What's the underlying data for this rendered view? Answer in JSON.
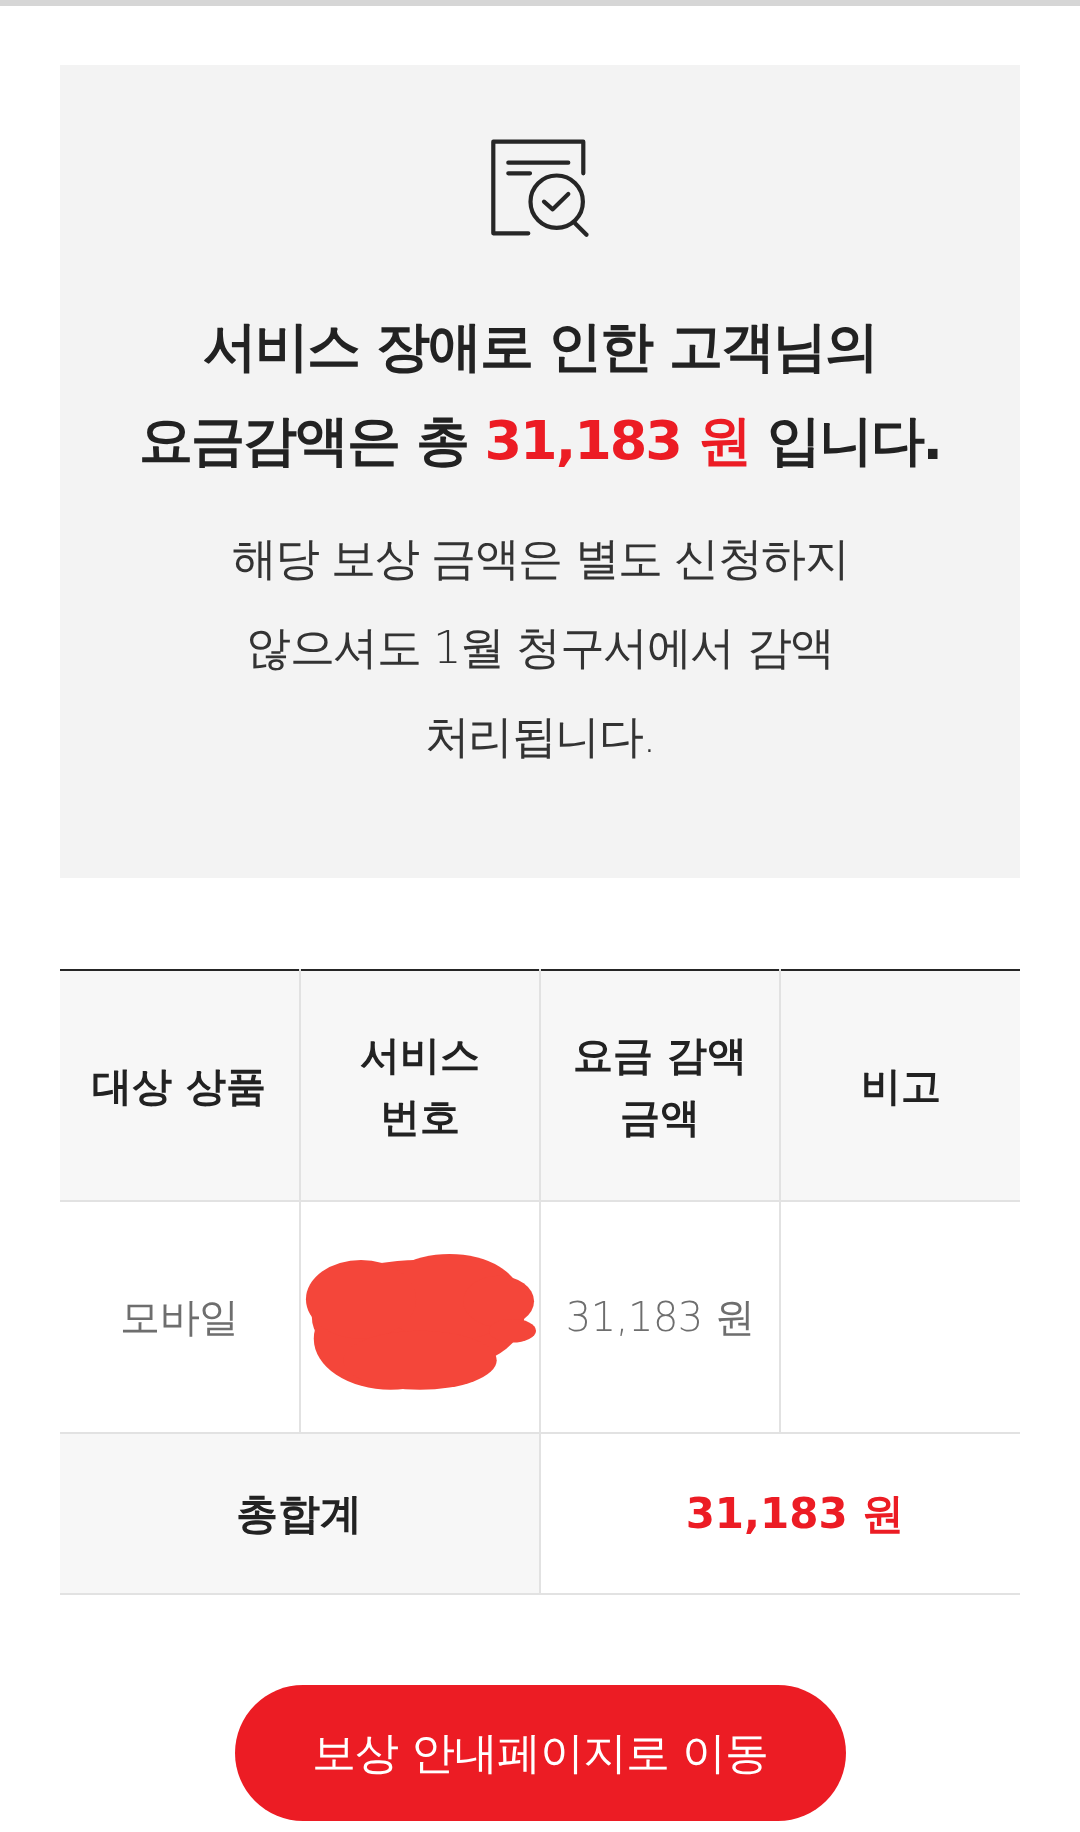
{
  "summary": {
    "title": [
      {
        "text": "서비스 장애로 인한 고객님의 요금감액은 총 ",
        "emphasis": false
      },
      {
        "text": "31,183 원",
        "emphasis": true
      },
      {
        "text": " 입니다.",
        "emphasis": false
      }
    ],
    "note": "해당 보상 금액은 별도 신청하지 않으셔도 1월 청구서에서 감액 처리됩니다."
  },
  "table": {
    "columns": [
      "대상 상품",
      "서비스 번호",
      "요금 감액 금액",
      "비고"
    ],
    "rows": [
      {
        "product": "모바일",
        "service_number_redacted": true,
        "amount": "31,183 원"
      }
    ],
    "total": {
      "label": "총합계",
      "amount": "31,183 원"
    }
  },
  "button": {
    "label": "보상 안내페이지로 이동"
  }
}
